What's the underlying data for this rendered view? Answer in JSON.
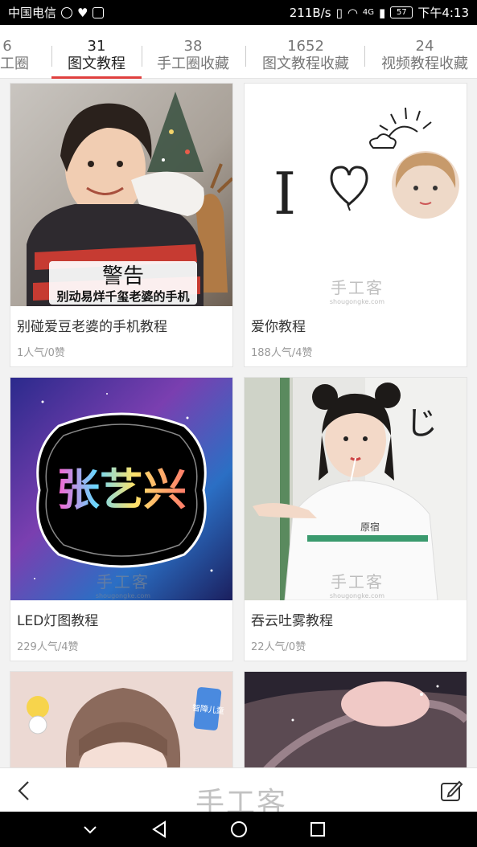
{
  "status_bar": {
    "carrier": "中国电信",
    "speed": "211B/s",
    "network": "4G",
    "battery": "57",
    "time": "下午4:13"
  },
  "tabs": [
    {
      "count": "6",
      "label": "手工圈",
      "active": false
    },
    {
      "count": "31",
      "label": "图文教程",
      "active": true
    },
    {
      "count": "38",
      "label": "手工圈收藏",
      "active": false
    },
    {
      "count": "1652",
      "label": "图文教程收藏",
      "active": false
    },
    {
      "count": "24",
      "label": "视频教程收藏",
      "active": false
    }
  ],
  "cards": [
    {
      "title": "别碰爱豆老婆的手机教程",
      "stats": "1人气/0赞",
      "image_text": {
        "warning": "警告",
        "caption": "别动易烊千玺老婆的手机"
      }
    },
    {
      "title": "爱你教程",
      "stats": "188人气/4赞",
      "image_text": {
        "letter": "I"
      }
    },
    {
      "title": "LED灯图教程",
      "stats": "229人气/4赞",
      "image_text": {
        "neon": "张艺兴"
      }
    },
    {
      "title": "吞云吐雾教程",
      "stats": "22人气/0赞",
      "image_text": {
        "shirt": "原宿"
      }
    },
    {
      "image_text": {
        "badge": "智障儿童"
      }
    },
    {}
  ],
  "watermark": {
    "text": "手工客",
    "url": "shougongke.com"
  },
  "colors": {
    "accent": "#e0403e",
    "background": "#f2f2f2"
  }
}
